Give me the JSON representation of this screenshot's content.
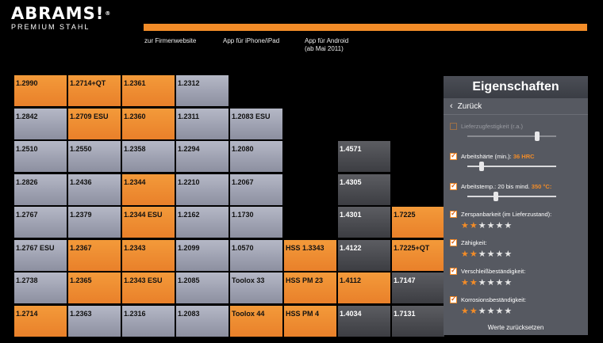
{
  "logo": {
    "main": "ABRAMS",
    "mark": "!",
    "reg": "®",
    "sub": "PREMIUM STAHL"
  },
  "nav": [
    {
      "label": "zur Firmenwebsite"
    },
    {
      "label": "App für iPhone/iPad"
    },
    {
      "label": "App für Android",
      "label2": "(ab Mai 2011)"
    }
  ],
  "colors": {
    "accent": "#f28c28",
    "gray_cell": "#a4a7b6",
    "dark_cell": "#4a4b50"
  },
  "columns": [
    [
      {
        "label": "1.2990",
        "style": "orange"
      },
      {
        "label": "1.2842",
        "style": "gray"
      },
      {
        "label": "1.2510",
        "style": "gray"
      },
      {
        "label": "1.2826",
        "style": "gray"
      },
      {
        "label": "1.2767",
        "style": "gray"
      },
      {
        "label": "1.2767 ESU",
        "style": "gray"
      },
      {
        "label": "1.2738",
        "style": "gray"
      },
      {
        "label": "1.2714",
        "style": "orange"
      }
    ],
    [
      {
        "label": "1.2714+QT",
        "style": "orange"
      },
      {
        "label": "1.2709 ESU",
        "style": "orange"
      },
      {
        "label": "1.2550",
        "style": "gray"
      },
      {
        "label": "1.2436",
        "style": "gray"
      },
      {
        "label": "1.2379",
        "style": "gray"
      },
      {
        "label": "1.2367",
        "style": "orange"
      },
      {
        "label": "1.2365",
        "style": "orange"
      },
      {
        "label": "1.2363",
        "style": "gray"
      }
    ],
    [
      {
        "label": "1.2361",
        "style": "orange"
      },
      {
        "label": "1.2360",
        "style": "orange"
      },
      {
        "label": "1.2358",
        "style": "gray"
      },
      {
        "label": "1.2344",
        "style": "orange"
      },
      {
        "label": "1.2344 ESU",
        "style": "orange"
      },
      {
        "label": "1.2343",
        "style": "orange"
      },
      {
        "label": "1.2343 ESU",
        "style": "orange"
      },
      {
        "label": "1.2316",
        "style": "gray"
      }
    ],
    [
      {
        "label": "1.2312",
        "style": "gray"
      },
      {
        "label": "1.2311",
        "style": "gray"
      },
      {
        "label": "1.2294",
        "style": "gray"
      },
      {
        "label": "1.2210",
        "style": "gray"
      },
      {
        "label": "1.2162",
        "style": "gray"
      },
      {
        "label": "1.2099",
        "style": "gray"
      },
      {
        "label": "1.2085",
        "style": "gray"
      },
      {
        "label": "1.2083",
        "style": "gray"
      }
    ],
    [
      {
        "label": "1.2083 ESU",
        "style": "gray"
      },
      {
        "label": "1.2080",
        "style": "gray"
      },
      {
        "label": "1.2067",
        "style": "gray"
      },
      {
        "label": "1.1730",
        "style": "gray"
      },
      {
        "label": "1.0570",
        "style": "gray"
      },
      {
        "label": "Toolox 33",
        "style": "gray"
      },
      {
        "label": "Toolox 44",
        "style": "orange"
      }
    ],
    [
      {
        "label": "HSS 1.3343",
        "style": "orange"
      },
      {
        "label": "HSS PM 23",
        "style": "orange"
      },
      {
        "label": "HSS PM 4",
        "style": "orange"
      }
    ],
    [
      {
        "label": "1.4571",
        "style": "dark"
      },
      {
        "label": "1.4305",
        "style": "dark"
      },
      {
        "label": "1.4301",
        "style": "dark"
      },
      {
        "label": "1.4122",
        "style": "dark"
      },
      {
        "label": "1.4112",
        "style": "orange"
      },
      {
        "label": "1.4034",
        "style": "dark"
      }
    ],
    [
      {
        "label": "1.7225",
        "style": "orange"
      },
      {
        "label": "1.7225+QT",
        "style": "orange"
      },
      {
        "label": "1.7147",
        "style": "dark"
      },
      {
        "label": "1.7131",
        "style": "dark"
      }
    ]
  ],
  "panel": {
    "title": "Eigenschaften",
    "back_label": "Zurück",
    "props": [
      {
        "label": "Lieferzugfestigkeit (r.a.)",
        "value": "",
        "checked": false,
        "kind": "slider",
        "level": 0.79
      },
      {
        "label": "Arbeitshärte (min.):",
        "value": "36 HRC",
        "checked": true,
        "kind": "slider",
        "level": 0.16
      },
      {
        "label": "Arbeitstemp.: 20 bis mind.",
        "value": "350 °C:",
        "checked": true,
        "kind": "slider",
        "level": 0.32
      },
      {
        "label": "Zerspanbarkeit (im Lieferzustand):",
        "value": "",
        "checked": true,
        "kind": "stars",
        "rating": 2,
        "max": 6
      },
      {
        "label": "Zähigkeit:",
        "value": "",
        "checked": true,
        "kind": "stars",
        "rating": 2,
        "max": 6
      },
      {
        "label": "Verschleißbeständigkeit:",
        "value": "",
        "checked": true,
        "kind": "stars",
        "rating": 2,
        "max": 6
      },
      {
        "label": "Korrosionsbeständigkeit:",
        "value": "",
        "checked": true,
        "kind": "stars",
        "rating": 2,
        "max": 6
      }
    ],
    "reset_label": "Werte zurücksetzen"
  }
}
